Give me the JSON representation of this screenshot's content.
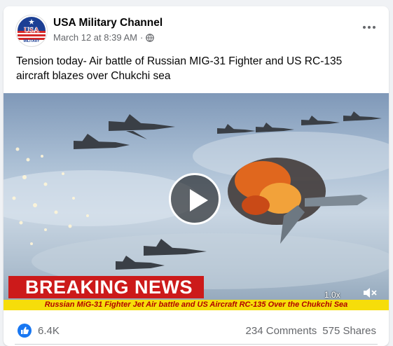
{
  "post": {
    "page_name": "USA Military Channel",
    "avatar_text": "USA",
    "avatar_subtext": "MILITARY",
    "timestamp": "March 12 at 8:39 AM",
    "separator": "·",
    "privacy_icon": "globe-icon",
    "text": "Tension today- Air battle of Russian MIG-31 Fighter and US RC-135 aircraft blazes over Chukchi sea"
  },
  "video": {
    "banner": "BREAKING NEWS",
    "ticker": "Russian MiG-31 Fighter Jet Air battle and US Aircraft RC-135 Over the Chukchi Sea",
    "playback_speed": "1.0x",
    "play_icon": "play-icon",
    "mute_icon": "muted-speaker-icon"
  },
  "stats": {
    "reaction_icon": "like-icon",
    "likes": "6.4K",
    "comments": "234 Comments",
    "shares": "575 Shares"
  },
  "colors": {
    "banner_red": "#cc1a1a",
    "ticker_yellow": "#f6dd0a",
    "facebook_blue": "#1877f2"
  }
}
